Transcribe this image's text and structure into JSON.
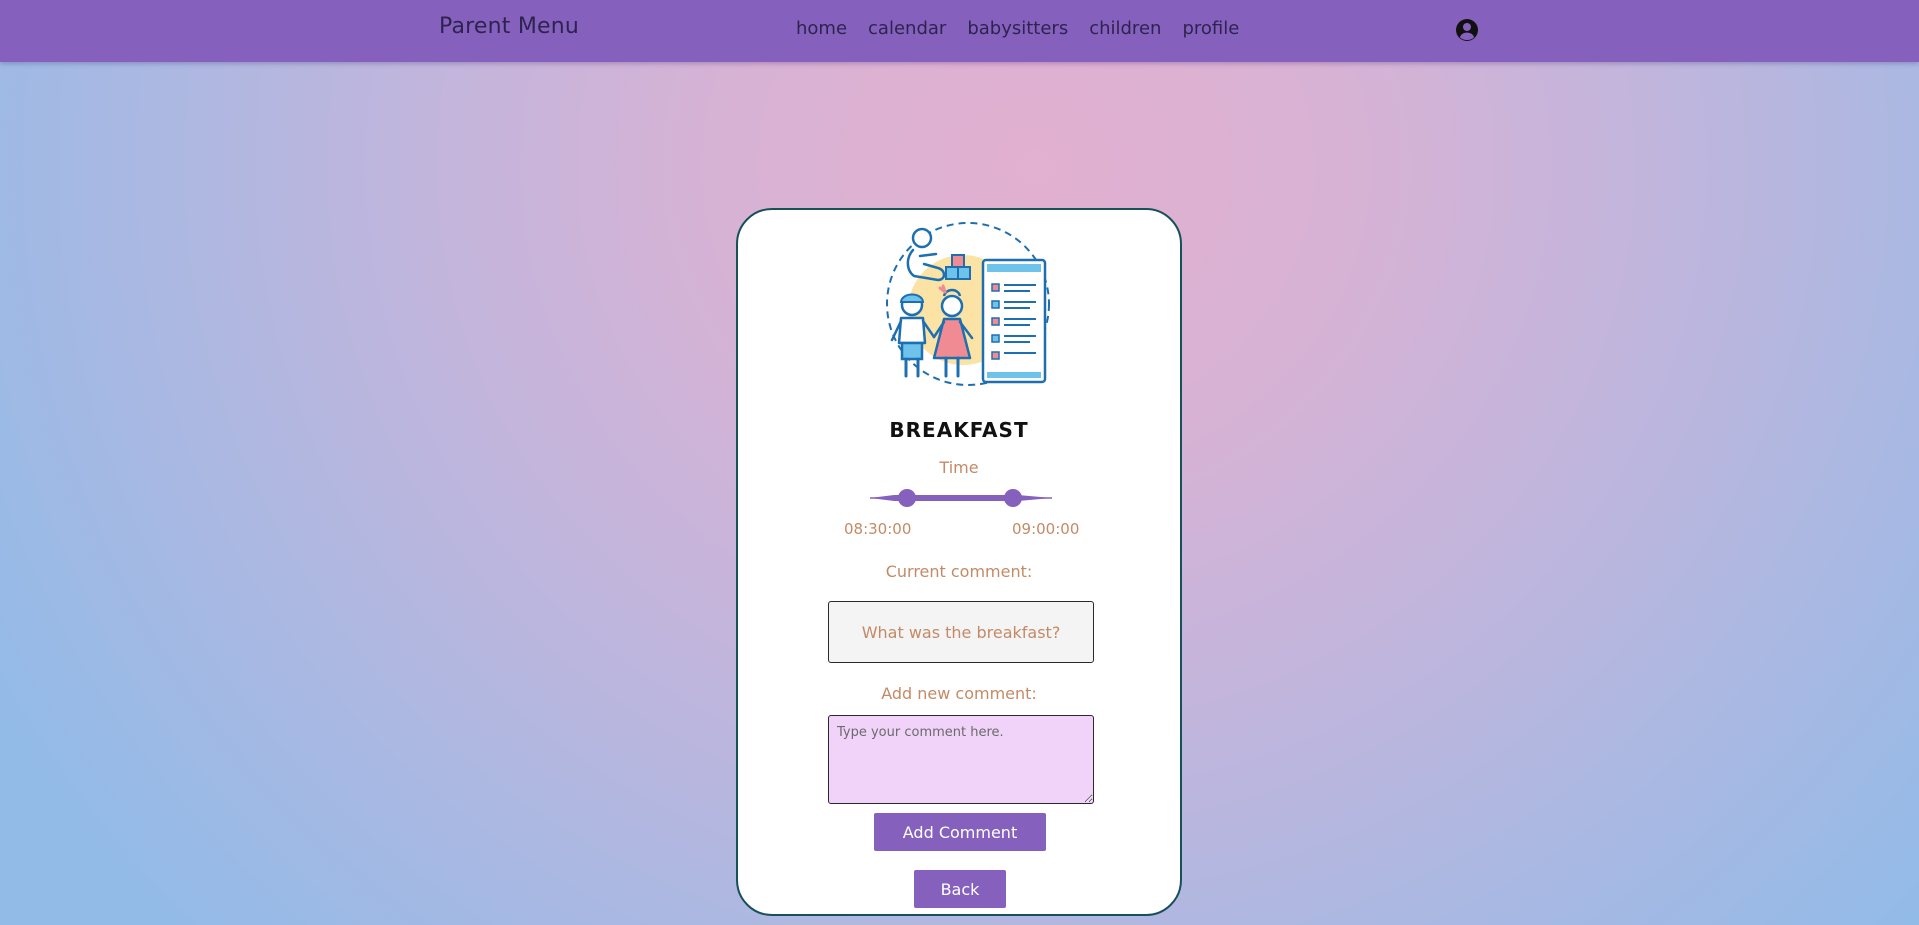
{
  "navbar": {
    "brand": "Parent Menu",
    "links": [
      {
        "label": "home"
      },
      {
        "label": "calendar"
      },
      {
        "label": "babysitters"
      },
      {
        "label": "children"
      },
      {
        "label": "profile"
      }
    ],
    "profile_icon": "user-circle-icon"
  },
  "card": {
    "illustration": "childcare-checklist-illustration",
    "title": "BREAKFAST",
    "time_label": "Time",
    "time_range": {
      "start": "08:30:00",
      "end": "09:00:00"
    },
    "current_comment_label": "Current comment:",
    "current_comment": "What was the breakfast?",
    "new_comment_label": "Add new comment:",
    "new_comment_placeholder": "Type your comment here.",
    "add_button": "Add Comment",
    "back_button": "Back"
  },
  "colors": {
    "navbar": "#8561bd",
    "accent": "#8561bd",
    "label_text": "#c48a66",
    "card_border": "#16505a",
    "comment_input_bg": "#f1d3fa"
  }
}
